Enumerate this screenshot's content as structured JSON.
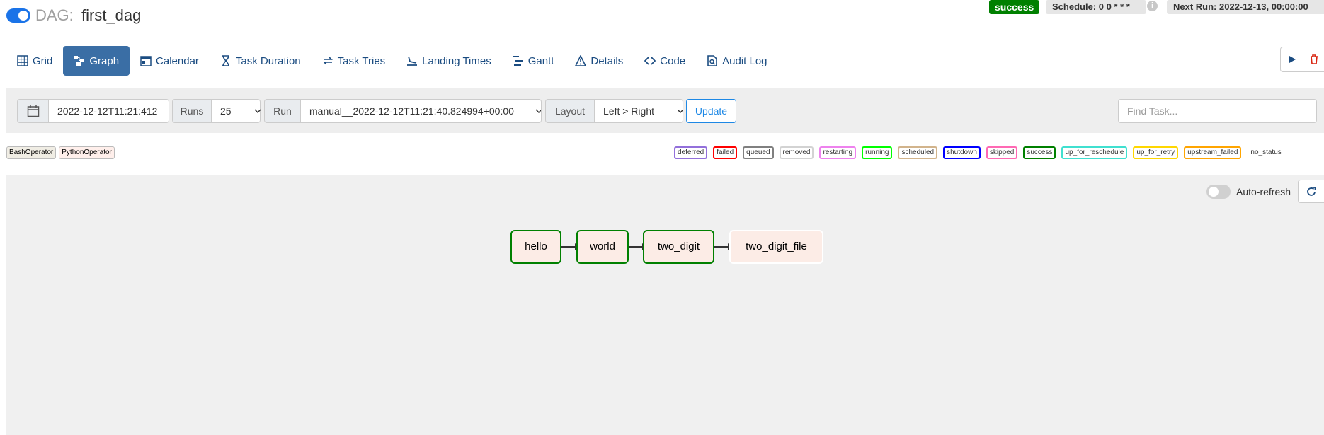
{
  "header": {
    "dag_prefix": "DAG:",
    "dag_id": "first_dag",
    "state_badge": "success",
    "schedule": "Schedule: 0 0 * * *",
    "next_run": "Next Run: 2022-12-13, 00:00:00"
  },
  "tabs": [
    {
      "label": "Grid",
      "icon": "grid-icon"
    },
    {
      "label": "Graph",
      "icon": "graph-icon",
      "active": true
    },
    {
      "label": "Calendar",
      "icon": "calendar-icon"
    },
    {
      "label": "Task Duration",
      "icon": "hourglass-icon"
    },
    {
      "label": "Task Tries",
      "icon": "retry-icon"
    },
    {
      "label": "Landing Times",
      "icon": "landing-icon"
    },
    {
      "label": "Gantt",
      "icon": "gantt-icon"
    },
    {
      "label": "Details",
      "icon": "warning-triangle-icon"
    },
    {
      "label": "Code",
      "icon": "code-icon"
    },
    {
      "label": "Audit Log",
      "icon": "audit-log-icon"
    }
  ],
  "filters": {
    "base_date": "2022-12-12T11:21:412",
    "runs_label": "Runs",
    "runs_value": "25",
    "run_label": "Run",
    "run_value": "manual__2022-12-12T11:21:40.824994+00:00",
    "layout_label": "Layout",
    "layout_value": "Left > Right",
    "update_label": "Update",
    "find_task_placeholder": "Find Task..."
  },
  "operators": [
    {
      "label": "BashOperator",
      "bg": "#f0ede4"
    },
    {
      "label": "PythonOperator",
      "bg": "#ffefeb"
    }
  ],
  "statuses": [
    {
      "label": "deferred",
      "color": "#9370db"
    },
    {
      "label": "failed",
      "color": "#ff0000"
    },
    {
      "label": "queued",
      "color": "#808080"
    },
    {
      "label": "removed",
      "color": "#d3d3d3"
    },
    {
      "label": "restarting",
      "color": "#ee82ee"
    },
    {
      "label": "running",
      "color": "#00ff00"
    },
    {
      "label": "scheduled",
      "color": "#d2b48c"
    },
    {
      "label": "shutdown",
      "color": "#0000ff"
    },
    {
      "label": "skipped",
      "color": "#ff69b4"
    },
    {
      "label": "success",
      "color": "#008000"
    },
    {
      "label": "up_for_reschedule",
      "color": "#40e0d0"
    },
    {
      "label": "up_for_retry",
      "color": "#ffd700"
    },
    {
      "label": "upstream_failed",
      "color": "#ffa500"
    },
    {
      "label": "no_status",
      "color": "transparent"
    }
  ],
  "graph": {
    "auto_refresh_label": "Auto-refresh",
    "tasks": [
      {
        "label": "hello",
        "state": "success"
      },
      {
        "label": "world",
        "state": "success"
      },
      {
        "label": "two_digit",
        "state": "success"
      },
      {
        "label": "two_digit_file",
        "state": "no_status"
      }
    ]
  }
}
